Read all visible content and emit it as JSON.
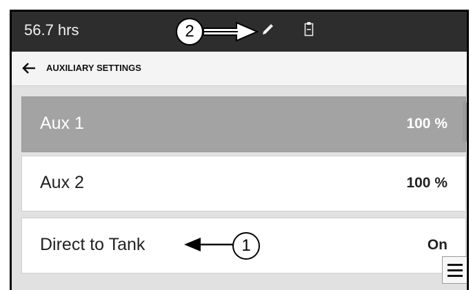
{
  "status_bar": {
    "hours": "56.7 hrs",
    "icons": [
      "pencil-icon",
      "clipboard-icon"
    ]
  },
  "header": {
    "title": "AUXILIARY SETTINGS",
    "back_icon": "back-arrow-icon"
  },
  "list": {
    "items": [
      {
        "label": "Aux 1",
        "value": "100 %",
        "selected": true
      },
      {
        "label": "Aux 2",
        "value": "100 %",
        "selected": false
      },
      {
        "label": "Direct to Tank",
        "value": "On",
        "selected": false
      }
    ]
  },
  "callouts": [
    "1",
    "2"
  ],
  "menu": {
    "icon": "hamburger-menu-icon"
  },
  "colors": {
    "status_bar_bg": "#2d2d2d",
    "selected_row_bg": "#a3a3a3",
    "page_bg": "#e1e1e1"
  }
}
